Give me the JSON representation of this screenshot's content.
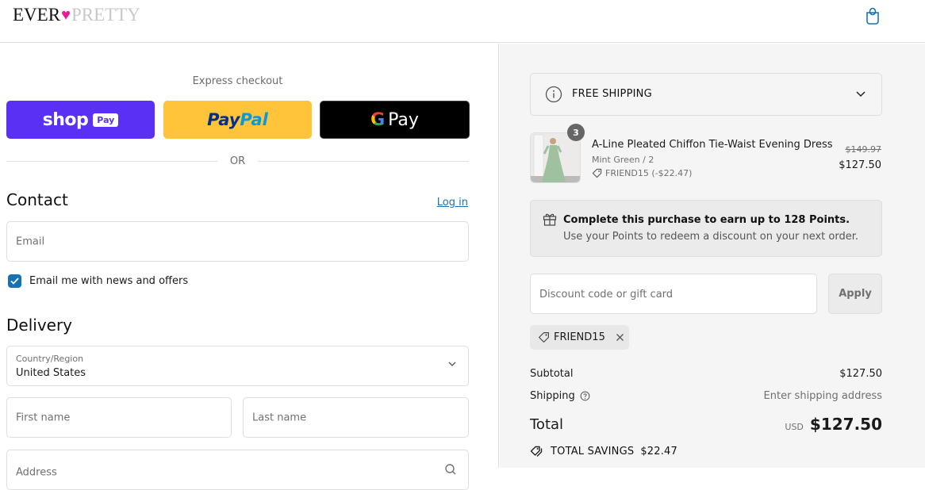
{
  "header": {
    "logo": {
      "part1": "EVER",
      "heart": "♥",
      "part2": "PRETTY"
    },
    "cart_icon": "shopping-bag-icon"
  },
  "checkout": {
    "express_label": "Express checkout",
    "shop_pay": {
      "word": "shop",
      "badge": "Pay"
    },
    "paypal": {
      "part1": "Pay",
      "part2": "Pal"
    },
    "gpay": {
      "g": "G",
      "pay": "Pay"
    },
    "or_label": "OR",
    "contact": {
      "heading": "Contact",
      "login_link": "Log in",
      "email_placeholder": "Email",
      "newsletter_label": "Email me with news and offers",
      "newsletter_checked": true
    },
    "delivery": {
      "heading": "Delivery",
      "country_label": "Country/Region",
      "country_value": "United States",
      "first_name_placeholder": "First name",
      "last_name_placeholder": "Last name",
      "address_placeholder": "Address"
    }
  },
  "summary": {
    "shipping_banner": "FREE SHIPPING",
    "item": {
      "quantity": "3",
      "name": "A-Line Pleated Chiffon Tie-Waist Evening Dress",
      "variant": "Mint Green / 2",
      "discount": "FRIEND15 (-$22.47)",
      "original_price": "$149.97",
      "price": "$127.50"
    },
    "points": {
      "title": "Complete this purchase to earn up to 128 Points.",
      "subtitle": "Use your Points to redeem a discount on your next order."
    },
    "discount_placeholder": "Discount code or gift card",
    "apply_label": "Apply",
    "applied_code": "FRIEND15",
    "subtotal_label": "Subtotal",
    "subtotal_value": "$127.50",
    "shipping_label": "Shipping",
    "shipping_value": "Enter shipping address",
    "total_label": "Total",
    "currency": "USD",
    "total_value": "$127.50",
    "savings_label": "TOTAL SAVINGS",
    "savings_value": "$22.47"
  },
  "colors": {
    "shop_pay": "#5a31f4",
    "paypal": "#ffc439",
    "link": "#1773b0",
    "logo_heart": "#f0169a"
  }
}
